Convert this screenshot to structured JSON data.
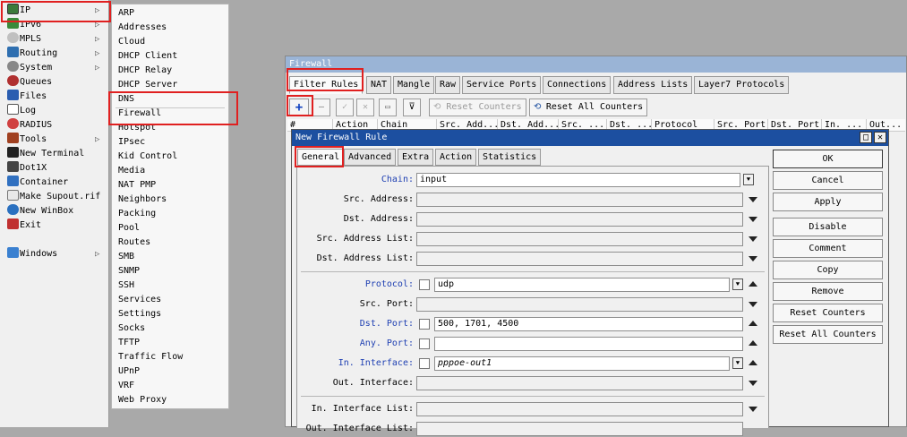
{
  "main_menu": {
    "items": [
      {
        "label": "IP",
        "icon": "ip-icon",
        "arrow": true
      },
      {
        "label": "IPv6",
        "icon": "ipv6-icon",
        "arrow": true
      },
      {
        "label": "MPLS",
        "icon": "mpls-icon",
        "arrow": true
      },
      {
        "label": "Routing",
        "icon": "routing-icon",
        "arrow": true
      },
      {
        "label": "System",
        "icon": "gear-icon",
        "arrow": true
      },
      {
        "label": "Queues",
        "icon": "queues-icon",
        "arrow": false
      },
      {
        "label": "Files",
        "icon": "folder-icon",
        "arrow": false
      },
      {
        "label": "Log",
        "icon": "log-icon",
        "arrow": false
      },
      {
        "label": "RADIUS",
        "icon": "radius-icon",
        "arrow": false
      },
      {
        "label": "Tools",
        "icon": "tools-icon",
        "arrow": true
      },
      {
        "label": "New Terminal",
        "icon": "terminal-icon",
        "arrow": false
      },
      {
        "label": "Dot1X",
        "icon": "dot1x-icon",
        "arrow": false
      },
      {
        "label": "Container",
        "icon": "container-icon",
        "arrow": false
      },
      {
        "label": "Make Supout.rif",
        "icon": "supout-icon",
        "arrow": false
      },
      {
        "label": "New WinBox",
        "icon": "winbox-icon",
        "arrow": false
      },
      {
        "label": "Exit",
        "icon": "exit-icon",
        "arrow": false
      },
      {
        "label": "Windows",
        "icon": "windows-icon",
        "arrow": true
      }
    ]
  },
  "ip_submenu": {
    "items": [
      "ARP",
      "Addresses",
      "Cloud",
      "DHCP Client",
      "DHCP Relay",
      "DHCP Server",
      "DNS",
      "Firewall",
      "Hotspot",
      "IPsec",
      "Kid Control",
      "Media",
      "NAT PMP",
      "Neighbors",
      "Packing",
      "Pool",
      "Routes",
      "SMB",
      "SNMP",
      "SSH",
      "Services",
      "Settings",
      "Socks",
      "TFTP",
      "Traffic Flow",
      "UPnP",
      "VRF",
      "Web Proxy"
    ]
  },
  "firewall": {
    "title": "Firewall",
    "tabs": [
      "Filter Rules",
      "NAT",
      "Mangle",
      "Raw",
      "Service Ports",
      "Connections",
      "Address Lists",
      "Layer7 Protocols"
    ],
    "toolbar": {
      "add": "+",
      "remove": "—",
      "enable": "✓",
      "disable": "✕",
      "comment": "▭",
      "filter": "⊽",
      "reset_counters": "Reset Counters",
      "reset_all_counters": "Reset All Counters"
    },
    "columns": [
      "#",
      "Action",
      "Chain",
      "Src. Add...",
      "Dst. Add...",
      "Src. ...",
      "Dst. ...",
      "Protocol",
      "Src. Port",
      "Dst. Port",
      "In. ...",
      "Out..."
    ]
  },
  "dialog": {
    "title": "New Firewall Rule",
    "tabs": [
      "General",
      "Advanced",
      "Extra",
      "Action",
      "Statistics"
    ],
    "fields": {
      "chain": {
        "label": "Chain:",
        "value": "input"
      },
      "src_address": {
        "label": "Src. Address:",
        "value": ""
      },
      "dst_address": {
        "label": "Dst. Address:",
        "value": ""
      },
      "src_address_list": {
        "label": "Src. Address List:",
        "value": ""
      },
      "dst_address_list": {
        "label": "Dst. Address List:",
        "value": ""
      },
      "protocol": {
        "label": "Protocol:",
        "value": "udp"
      },
      "src_port": {
        "label": "Src. Port:",
        "value": ""
      },
      "dst_port": {
        "label": "Dst. Port:",
        "value": "500, 1701, 4500"
      },
      "any_port": {
        "label": "Any. Port:",
        "value": ""
      },
      "in_interface": {
        "label": "In. Interface:",
        "value": "pppoe-out1"
      },
      "out_interface": {
        "label": "Out. Interface:",
        "value": ""
      },
      "in_interface_list": {
        "label": "In. Interface List:",
        "value": ""
      },
      "out_interface_list": {
        "label": "Out. Interface List:",
        "value": ""
      }
    },
    "buttons": [
      "OK",
      "Cancel",
      "Apply",
      "Disable",
      "Comment",
      "Copy",
      "Remove",
      "Reset Counters",
      "Reset All Counters"
    ]
  },
  "colors": {
    "highlight_box": "#e02020",
    "dialog_title": "#1c4fa0",
    "menu_sidebar": "#1f3e8c",
    "blue_label": "#1e3fb2"
  }
}
